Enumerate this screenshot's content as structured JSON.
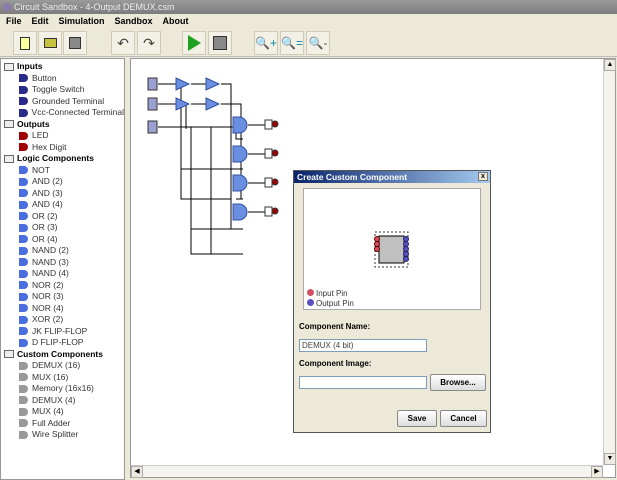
{
  "window": {
    "title": "Circuit Sandbox - 4-Output DEMUX.csm"
  },
  "menu": [
    "File",
    "Edit",
    "Simulation",
    "Sandbox",
    "About"
  ],
  "toolbar": [
    "new-icon",
    "open-icon",
    "save-icon",
    "undo-icon",
    "redo-icon",
    "run-icon",
    "stop-icon",
    "zoom-in-icon",
    "zoom-reset-icon",
    "zoom-out-icon"
  ],
  "palette": [
    {
      "category": "Inputs",
      "items": [
        "Button",
        "Toggle Switch",
        "Grounded Terminal",
        "Vcc-Connected Terminal"
      ]
    },
    {
      "category": "Outputs",
      "items": [
        "LED",
        "Hex Digit"
      ]
    },
    {
      "category": "Logic Components",
      "items": [
        "NOT",
        "AND (2)",
        "AND (3)",
        "AND (4)",
        "OR (2)",
        "OR (3)",
        "OR (4)",
        "NAND (2)",
        "NAND (3)",
        "NAND (4)",
        "NOR (2)",
        "NOR (3)",
        "NOR (4)",
        "XOR (2)",
        "JK FLIP-FLOP",
        "D FLIP-FLOP"
      ]
    },
    {
      "category": "Custom Components",
      "items": [
        "DEMUX (16)",
        "MUX (16)",
        "Memory (16x16)",
        "DEMUX (4)",
        "MUX (4)",
        "Full Adder",
        "Wire Splitter"
      ]
    }
  ],
  "dialog": {
    "title": "Create Custom Component",
    "close": "x",
    "legend_input": "Input Pin",
    "legend_output": "Output Pin",
    "name_label": "Component Name:",
    "name_value": "DEMUX (4 bit)",
    "image_label": "Component Image:",
    "image_value": "",
    "browse": "Browse...",
    "save": "Save",
    "cancel": "Cancel"
  },
  "colors": {
    "gate": "#6a8fe0",
    "led": "#a00000",
    "input_pin": "#d05060",
    "output_pin": "#5a50c0"
  }
}
